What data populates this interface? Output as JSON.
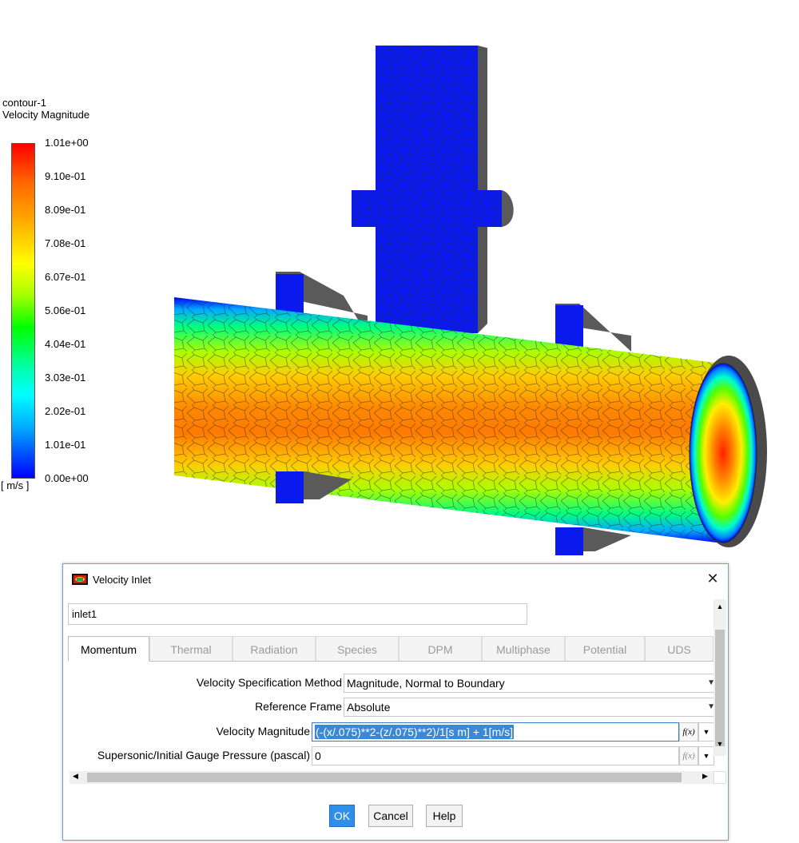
{
  "legend": {
    "name": "contour-1",
    "quantity": "Velocity Magnitude",
    "unit": "[ m/s ]",
    "ticks": [
      "1.01e+00",
      "9.10e-01",
      "8.09e-01",
      "7.08e-01",
      "6.07e-01",
      "5.06e-01",
      "4.04e-01",
      "3.03e-01",
      "2.02e-01",
      "1.01e-01",
      "0.00e+00"
    ],
    "colors": [
      "#ff0000",
      "#ff8000",
      "#ffff00",
      "#00ff00",
      "#00ffff",
      "#0000ff"
    ]
  },
  "dialog": {
    "title": "Velocity Inlet",
    "zone_name": "inlet1",
    "tabs": [
      "Momentum",
      "Thermal",
      "Radiation",
      "Species",
      "DPM",
      "Multiphase",
      "Potential",
      "UDS"
    ],
    "active_tab": "Momentum",
    "fields": {
      "spec_method_label": "Velocity Specification Method",
      "spec_method_value": "Magnitude, Normal to Boundary",
      "ref_frame_label": "Reference Frame",
      "ref_frame_value": "Absolute",
      "vel_mag_label": "Velocity Magnitude",
      "vel_mag_value": "(-(x/.075)**2-(z/.075)**2)/1[s m] + 1[m/s]",
      "pressure_label": "Supersonic/Initial Gauge Pressure (pascal)",
      "pressure_value": "0",
      "fx_label": "f(x)"
    },
    "buttons": {
      "ok": "OK",
      "cancel": "Cancel",
      "help": "Help"
    }
  }
}
